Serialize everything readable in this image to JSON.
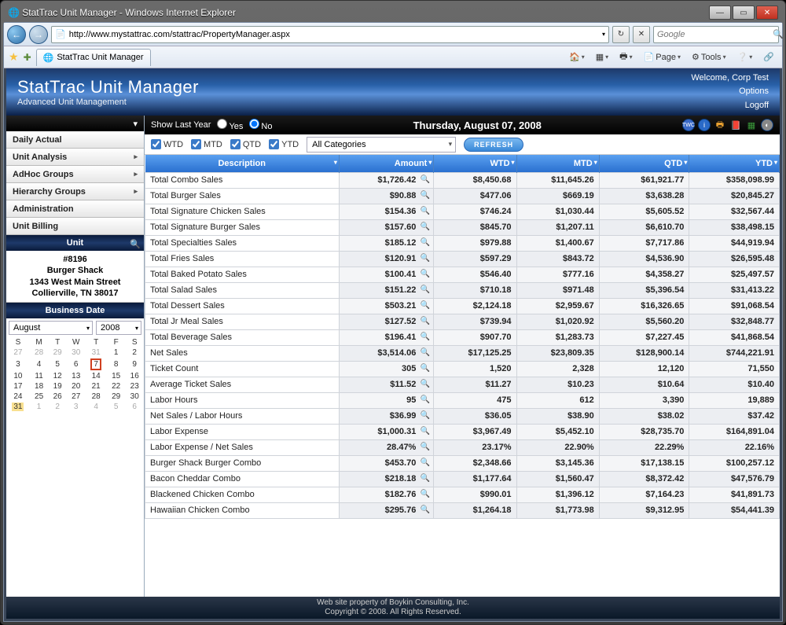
{
  "window": {
    "title": "StatTrac Unit Manager - Windows Internet Explorer"
  },
  "browser": {
    "url": "http://www.mystattrac.com/stattrac/PropertyManager.aspx",
    "search_placeholder": "Google",
    "tab_title": "StatTrac Unit Manager",
    "toolbar": {
      "page": "Page",
      "tools": "Tools"
    }
  },
  "header": {
    "title": "StatTrac Unit Manager",
    "subtitle": "Advanced Unit Management",
    "welcome": "Welcome, Corp Test",
    "options": "Options",
    "logoff": "Logoff"
  },
  "topbar": {
    "show_last_year": "Show Last Year",
    "yes": "Yes",
    "no": "No",
    "date_display": "Thursday, August 07, 2008"
  },
  "filters": {
    "wtd": "WTD",
    "mtd": "MTD",
    "qtd": "QTD",
    "ytd": "YTD",
    "category": "All Categories",
    "refresh": "REFRESH"
  },
  "sidebar": {
    "items": [
      {
        "label": "Daily Actual",
        "expand": false
      },
      {
        "label": "Unit Analysis",
        "expand": true
      },
      {
        "label": "AdHoc Groups",
        "expand": true
      },
      {
        "label": "Hierarchy Groups",
        "expand": true
      },
      {
        "label": "Administration",
        "expand": false
      },
      {
        "label": "Unit Billing",
        "expand": false
      }
    ],
    "unit_head": "Unit",
    "unit": {
      "id": "#8196",
      "name": "Burger Shack",
      "street": "1343 West Main Street",
      "citystate": "Collierville, TN 38017"
    },
    "bd_head": "Business Date",
    "cal_month": "August",
    "cal_year": "2008",
    "dow": [
      "S",
      "M",
      "T",
      "W",
      "T",
      "F",
      "S"
    ],
    "weeks": [
      [
        {
          "d": "27",
          "o": 1
        },
        {
          "d": "28",
          "o": 1
        },
        {
          "d": "29",
          "o": 1
        },
        {
          "d": "30",
          "o": 1
        },
        {
          "d": "31",
          "o": 1
        },
        {
          "d": "1"
        },
        {
          "d": "2"
        }
      ],
      [
        {
          "d": "3"
        },
        {
          "d": "4"
        },
        {
          "d": "5"
        },
        {
          "d": "6"
        },
        {
          "d": "7",
          "sel": 1
        },
        {
          "d": "8"
        },
        {
          "d": "9"
        }
      ],
      [
        {
          "d": "10"
        },
        {
          "d": "11"
        },
        {
          "d": "12"
        },
        {
          "d": "13"
        },
        {
          "d": "14"
        },
        {
          "d": "15"
        },
        {
          "d": "16"
        }
      ],
      [
        {
          "d": "17"
        },
        {
          "d": "18"
        },
        {
          "d": "19"
        },
        {
          "d": "20"
        },
        {
          "d": "21"
        },
        {
          "d": "22"
        },
        {
          "d": "23"
        }
      ],
      [
        {
          "d": "24"
        },
        {
          "d": "25"
        },
        {
          "d": "26"
        },
        {
          "d": "27"
        },
        {
          "d": "28"
        },
        {
          "d": "29"
        },
        {
          "d": "30"
        }
      ],
      [
        {
          "d": "31",
          "hl": 1
        },
        {
          "d": "1",
          "o": 1
        },
        {
          "d": "2",
          "o": 1
        },
        {
          "d": "3",
          "o": 1
        },
        {
          "d": "4",
          "o": 1
        },
        {
          "d": "5",
          "o": 1
        },
        {
          "d": "6",
          "o": 1
        }
      ]
    ]
  },
  "table": {
    "headers": [
      "Description",
      "Amount",
      "WTD",
      "MTD",
      "QTD",
      "YTD"
    ],
    "rows": [
      {
        "desc": "Total Combo Sales",
        "amt": "$1,726.42",
        "wtd": "$8,450.68",
        "mtd": "$11,645.26",
        "qtd": "$61,921.77",
        "ytd": "$358,098.99"
      },
      {
        "desc": "Total Burger Sales",
        "amt": "$90.88",
        "wtd": "$477.06",
        "mtd": "$669.19",
        "qtd": "$3,638.28",
        "ytd": "$20,845.27"
      },
      {
        "desc": "Total Signature Chicken Sales",
        "amt": "$154.36",
        "wtd": "$746.24",
        "mtd": "$1,030.44",
        "qtd": "$5,605.52",
        "ytd": "$32,567.44"
      },
      {
        "desc": "Total Signature Burger Sales",
        "amt": "$157.60",
        "wtd": "$845.70",
        "mtd": "$1,207.11",
        "qtd": "$6,610.70",
        "ytd": "$38,498.15"
      },
      {
        "desc": "Total Specialties Sales",
        "amt": "$185.12",
        "wtd": "$979.88",
        "mtd": "$1,400.67",
        "qtd": "$7,717.86",
        "ytd": "$44,919.94"
      },
      {
        "desc": "Total Fries Sales",
        "amt": "$120.91",
        "wtd": "$597.29",
        "mtd": "$843.72",
        "qtd": "$4,536.90",
        "ytd": "$26,595.48"
      },
      {
        "desc": "Total Baked Potato Sales",
        "amt": "$100.41",
        "wtd": "$546.40",
        "mtd": "$777.16",
        "qtd": "$4,358.27",
        "ytd": "$25,497.57"
      },
      {
        "desc": "Total Salad Sales",
        "amt": "$151.22",
        "wtd": "$710.18",
        "mtd": "$971.48",
        "qtd": "$5,396.54",
        "ytd": "$31,413.22"
      },
      {
        "desc": "Total Dessert Sales",
        "amt": "$503.21",
        "wtd": "$2,124.18",
        "mtd": "$2,959.67",
        "qtd": "$16,326.65",
        "ytd": "$91,068.54"
      },
      {
        "desc": "Total Jr Meal Sales",
        "amt": "$127.52",
        "wtd": "$739.94",
        "mtd": "$1,020.92",
        "qtd": "$5,560.20",
        "ytd": "$32,848.77"
      },
      {
        "desc": "Total Beverage Sales",
        "amt": "$196.41",
        "wtd": "$907.70",
        "mtd": "$1,283.73",
        "qtd": "$7,227.45",
        "ytd": "$41,868.54"
      },
      {
        "desc": "Net Sales",
        "amt": "$3,514.06",
        "wtd": "$17,125.25",
        "mtd": "$23,809.35",
        "qtd": "$128,900.14",
        "ytd": "$744,221.91"
      },
      {
        "desc": "Ticket Count",
        "amt": "305",
        "wtd": "1,520",
        "mtd": "2,328",
        "qtd": "12,120",
        "ytd": "71,550"
      },
      {
        "desc": "Average Ticket Sales",
        "amt": "$11.52",
        "wtd": "$11.27",
        "mtd": "$10.23",
        "qtd": "$10.64",
        "ytd": "$10.40"
      },
      {
        "desc": "Labor Hours",
        "amt": "95",
        "wtd": "475",
        "mtd": "612",
        "qtd": "3,390",
        "ytd": "19,889"
      },
      {
        "desc": "Net Sales / Labor Hours",
        "amt": "$36.99",
        "wtd": "$36.05",
        "mtd": "$38.90",
        "qtd": "$38.02",
        "ytd": "$37.42"
      },
      {
        "desc": "Labor Expense",
        "amt": "$1,000.31",
        "wtd": "$3,967.49",
        "mtd": "$5,452.10",
        "qtd": "$28,735.70",
        "ytd": "$164,891.04"
      },
      {
        "desc": "Labor Expense / Net Sales",
        "amt": "28.47%",
        "wtd": "23.17%",
        "mtd": "22.90%",
        "qtd": "22.29%",
        "ytd": "22.16%"
      },
      {
        "desc": "Burger Shack Burger Combo",
        "amt": "$453.70",
        "wtd": "$2,348.66",
        "mtd": "$3,145.36",
        "qtd": "$17,138.15",
        "ytd": "$100,257.12"
      },
      {
        "desc": "Bacon Cheddar Combo",
        "amt": "$218.18",
        "wtd": "$1,177.64",
        "mtd": "$1,560.47",
        "qtd": "$8,372.42",
        "ytd": "$47,576.79"
      },
      {
        "desc": "Blackened Chicken Combo",
        "amt": "$182.76",
        "wtd": "$990.01",
        "mtd": "$1,396.12",
        "qtd": "$7,164.23",
        "ytd": "$41,891.73"
      },
      {
        "desc": "Hawaiian Chicken Combo",
        "amt": "$295.76",
        "wtd": "$1,264.18",
        "mtd": "$1,773.98",
        "qtd": "$9,312.95",
        "ytd": "$54,441.39"
      }
    ]
  },
  "footer": {
    "line1": "Web site property of Boykin Consulting, Inc.",
    "line2": "Copyright © 2008. All Rights Reserved."
  }
}
